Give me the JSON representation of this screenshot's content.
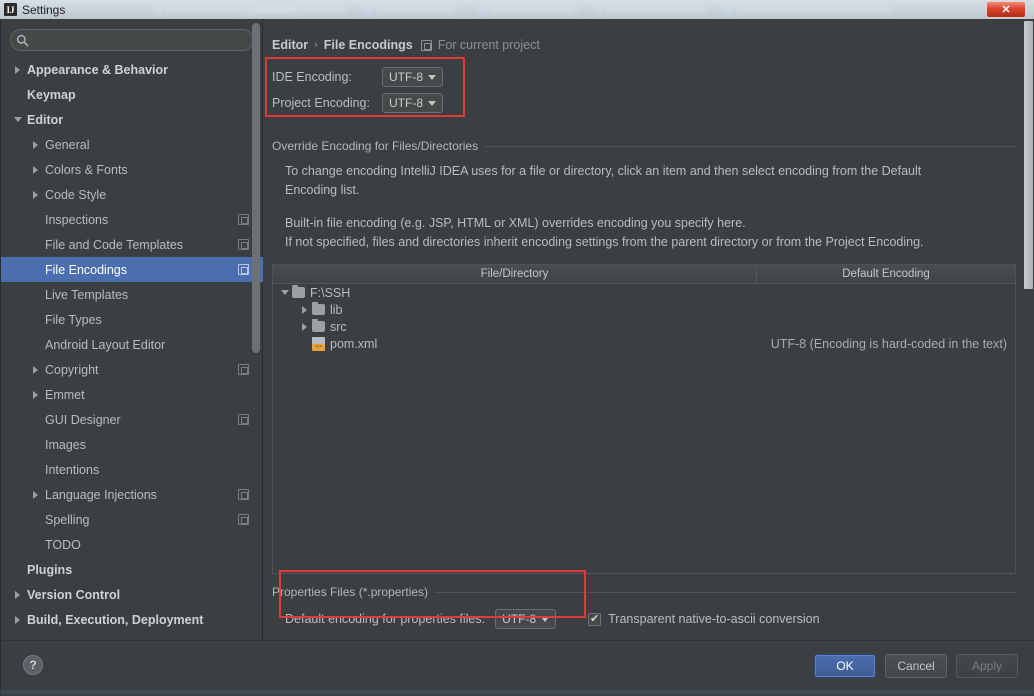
{
  "window": {
    "title": "Settings",
    "logo_glyph": "IJ",
    "close_label": "✕"
  },
  "background_tabs": [
    {
      "color": "#c8d2d8"
    },
    {
      "color": "#7ec46a"
    },
    {
      "color": "#6fb7e0"
    },
    {
      "color": "#6fb7e0"
    },
    {
      "color": "#7ec46a"
    },
    {
      "color": "#6fb7e0"
    }
  ],
  "search": {
    "value": "",
    "placeholder": "",
    "icon": "search-icon"
  },
  "sidebar": {
    "items": [
      {
        "label": "Appearance & Behavior",
        "level": 0,
        "toggle": "right",
        "bold": true,
        "badge": false,
        "selected": false
      },
      {
        "label": "Keymap",
        "level": 0,
        "toggle": "none",
        "bold": true,
        "badge": false,
        "selected": false
      },
      {
        "label": "Editor",
        "level": 0,
        "toggle": "down",
        "bold": true,
        "badge": false,
        "selected": false
      },
      {
        "label": "General",
        "level": 1,
        "toggle": "right",
        "bold": false,
        "badge": false,
        "selected": false
      },
      {
        "label": "Colors & Fonts",
        "level": 1,
        "toggle": "right",
        "bold": false,
        "badge": false,
        "selected": false
      },
      {
        "label": "Code Style",
        "level": 1,
        "toggle": "right",
        "bold": false,
        "badge": false,
        "selected": false
      },
      {
        "label": "Inspections",
        "level": 1,
        "toggle": "none",
        "bold": false,
        "badge": true,
        "selected": false
      },
      {
        "label": "File and Code Templates",
        "level": 1,
        "toggle": "none",
        "bold": false,
        "badge": true,
        "selected": false
      },
      {
        "label": "File Encodings",
        "level": 1,
        "toggle": "none",
        "bold": false,
        "badge": true,
        "selected": true
      },
      {
        "label": "Live Templates",
        "level": 1,
        "toggle": "none",
        "bold": false,
        "badge": false,
        "selected": false
      },
      {
        "label": "File Types",
        "level": 1,
        "toggle": "none",
        "bold": false,
        "badge": false,
        "selected": false
      },
      {
        "label": "Android Layout Editor",
        "level": 1,
        "toggle": "none",
        "bold": false,
        "badge": false,
        "selected": false
      },
      {
        "label": "Copyright",
        "level": 1,
        "toggle": "right",
        "bold": false,
        "badge": true,
        "selected": false
      },
      {
        "label": "Emmet",
        "level": 1,
        "toggle": "right",
        "bold": false,
        "badge": false,
        "selected": false
      },
      {
        "label": "GUI Designer",
        "level": 1,
        "toggle": "none",
        "bold": false,
        "badge": true,
        "selected": false
      },
      {
        "label": "Images",
        "level": 1,
        "toggle": "none",
        "bold": false,
        "badge": false,
        "selected": false
      },
      {
        "label": "Intentions",
        "level": 1,
        "toggle": "none",
        "bold": false,
        "badge": false,
        "selected": false
      },
      {
        "label": "Language Injections",
        "level": 1,
        "toggle": "right",
        "bold": false,
        "badge": true,
        "selected": false
      },
      {
        "label": "Spelling",
        "level": 1,
        "toggle": "none",
        "bold": false,
        "badge": true,
        "selected": false
      },
      {
        "label": "TODO",
        "level": 1,
        "toggle": "none",
        "bold": false,
        "badge": false,
        "selected": false
      },
      {
        "label": "Plugins",
        "level": 0,
        "toggle": "none",
        "bold": true,
        "badge": false,
        "selected": false
      },
      {
        "label": "Version Control",
        "level": 0,
        "toggle": "right",
        "bold": true,
        "badge": false,
        "selected": false
      },
      {
        "label": "Build, Execution, Deployment",
        "level": 0,
        "toggle": "right",
        "bold": true,
        "badge": false,
        "selected": false
      }
    ]
  },
  "main": {
    "breadcrumb": {
      "parent": "Editor",
      "separator": "›",
      "current": "File Encodings",
      "note": "For current project"
    },
    "encoding": {
      "ide_label": "IDE Encoding:",
      "ide_value": "UTF-8",
      "project_label": "Project Encoding:",
      "project_value": "UTF-8"
    },
    "override_group_title": "Override Encoding for Files/Directories",
    "description": {
      "line1": "To change encoding IntelliJ IDEA uses for a file or directory, click an item and then select encoding from the Default",
      "line2": "Encoding list.",
      "line3": "Built-in file encoding (e.g. JSP, HTML or XML) overrides encoding you specify here.",
      "line4": "If not specified, files and directories inherit encoding settings from the parent directory or from the Project Encoding."
    },
    "table": {
      "columns": [
        "File/Directory",
        "Default Encoding"
      ],
      "rows": [
        {
          "name": "F:\\SSH",
          "indent": 0,
          "toggle": "down",
          "icon": "folder-icon",
          "encoding": ""
        },
        {
          "name": "lib",
          "indent": 1,
          "toggle": "right",
          "icon": "folder-icon",
          "encoding": ""
        },
        {
          "name": "src",
          "indent": 1,
          "toggle": "right",
          "icon": "folder-icon",
          "encoding": ""
        },
        {
          "name": "pom.xml",
          "indent": 1,
          "toggle": "none",
          "icon": "xml-file-icon",
          "encoding": "UTF-8 (Encoding is hard-coded in the text)"
        }
      ]
    },
    "properties": {
      "group_title": "Properties Files (*.properties)",
      "label": "Default encoding for properties files:",
      "value": "UTF-8",
      "checkbox_label": "Transparent native-to-ascii conversion",
      "checkbox_checked": true,
      "check_glyph": "✔"
    }
  },
  "footer": {
    "help_label": "?",
    "ok_label": "OK",
    "cancel_label": "Cancel",
    "apply_label": "Apply"
  },
  "colors": {
    "accent": "#4b6eaf",
    "annotation": "#e03a3a",
    "background": "#3c3f41"
  }
}
